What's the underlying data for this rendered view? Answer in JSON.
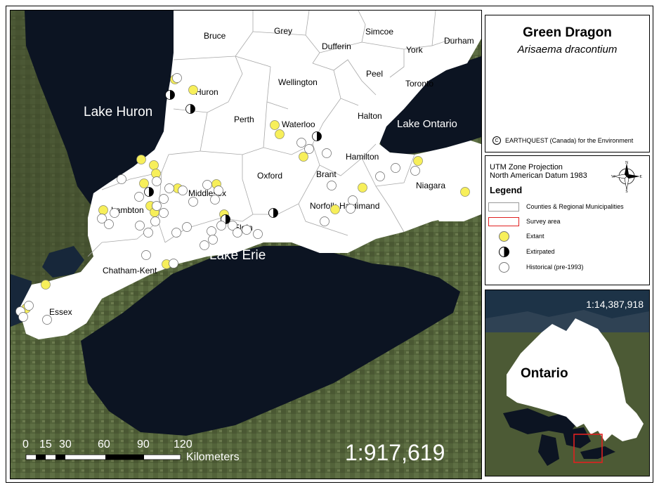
{
  "title": {
    "common_name": "Green Dragon",
    "scientific_name": "Arisaema dracontium"
  },
  "copyright": {
    "symbol": "C",
    "text": "EARTHQUEST (Canada) for the Environment"
  },
  "projection": {
    "line1": "UTM Zone Projection",
    "line2": "North American Datum 1983"
  },
  "compass": {
    "n": "N",
    "s": "S",
    "e": "E",
    "w": "W"
  },
  "legend": {
    "title": "Legend",
    "items": [
      {
        "label": "Counties & Regional Municipalities",
        "symbol": "polygon-white"
      },
      {
        "label": "Survey area",
        "symbol": "polygon-red-outline"
      },
      {
        "label": "Extant",
        "symbol": "yellow-circle"
      },
      {
        "label": "Extirpated",
        "symbol": "half-filled-circle"
      },
      {
        "label": "Historical (pre-1993)",
        "symbol": "white-circle"
      }
    ]
  },
  "map": {
    "counties": [
      "Bruce",
      "Grey",
      "Dufferin",
      "Simcoe",
      "Durham",
      "York",
      "Peel",
      "Toronto",
      "Wellington",
      "Huron",
      "Perth",
      "Waterloo",
      "Halton",
      "Hamilton",
      "Brant",
      "Oxford",
      "Middlesex",
      "Lambton",
      "Niagara",
      "Norfolk-Haldimand",
      "Elgin",
      "Chatham-Kent",
      "Essex"
    ],
    "lakes": [
      "Lake Huron",
      "Lake Ontario",
      "Lake Erie"
    ],
    "scale_ratio": "1:917,619",
    "scale_bar": {
      "ticks": [
        "0",
        "15",
        "30",
        "60",
        "90",
        "120"
      ],
      "unit": "Kilometers"
    }
  },
  "inset": {
    "scale_ratio": "1:14,387,918",
    "label": "Ontario"
  },
  "colors": {
    "extant": "#f7ef5a",
    "historical": "#ffffff",
    "extirpated": "#000000",
    "water": "#0c1422",
    "survey_outline": "#e02020"
  }
}
